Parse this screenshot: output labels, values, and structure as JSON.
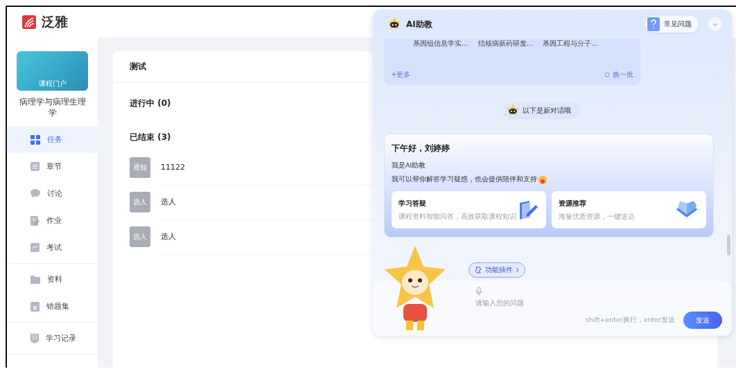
{
  "brand": {
    "name": "泛雅"
  },
  "course": {
    "cover_label": "课程门户",
    "title": "病理学与病理生理学"
  },
  "sidebar": {
    "groups": [
      [
        {
          "label": "任务",
          "selected": true
        },
        {
          "label": "章节",
          "selected": false
        },
        {
          "label": "讨论",
          "selected": false
        },
        {
          "label": "作业",
          "selected": false
        },
        {
          "label": "考试",
          "selected": false
        }
      ],
      [
        {
          "label": "资料",
          "selected": false
        },
        {
          "label": "错题集",
          "selected": false
        }
      ],
      [
        {
          "label": "学习记录",
          "selected": false
        }
      ]
    ]
  },
  "main": {
    "title": "测试",
    "sections": [
      {
        "label": "进行中 (0)"
      },
      {
        "label": "已结束 (3)",
        "items": [
          {
            "tag": "通知",
            "title": "11122"
          },
          {
            "tag": "选人",
            "title": "选人"
          },
          {
            "tag": "选人",
            "title": "选人"
          }
        ]
      }
    ]
  },
  "assistant": {
    "title": "AI助教",
    "faq_button": "常见问题",
    "courses": [
      "基因组信息学实...",
      "结核病新药研发...",
      "基因工程与分子..."
    ],
    "more_link": "+更多",
    "refresh_link": "换一批",
    "new_chat_note": "以下是新对话哦",
    "greeting": "下午好，刘婷婷",
    "intro": "我是AI助教",
    "description": "我可以帮你解答学习疑惑，也会提供陪伴和支持",
    "features": [
      {
        "title": "学习答疑",
        "subtitle": "课程资料智能问答，高效获取课程知识"
      },
      {
        "title": "资源推荐",
        "subtitle": "海量优质资源，一键送达"
      }
    ],
    "plugin_button": "功能插件",
    "input_placeholder": "请输入您的问题",
    "hint": "shift+enter换行，enter发送",
    "send_button": "发送"
  }
}
